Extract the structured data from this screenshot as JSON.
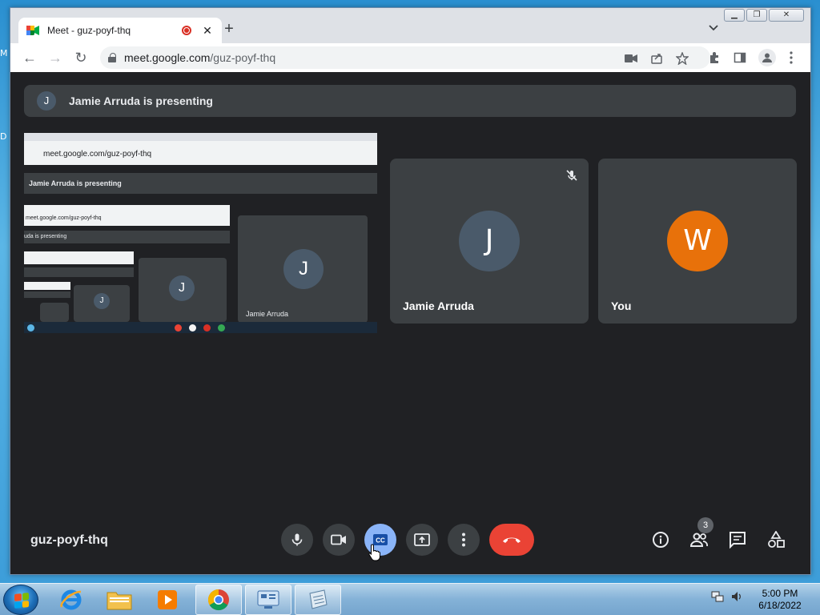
{
  "desktop": {
    "edge_letters": [
      "M",
      "D"
    ]
  },
  "browser": {
    "tab": {
      "title": "Meet - guz-poyf-thq"
    },
    "new_tab": "+",
    "tab_close": "✕",
    "tab_search": "⌄",
    "window_controls": {
      "minimize": "▁",
      "restore": "❐",
      "close": "✕"
    },
    "omnibox": {
      "host": "meet.google.com",
      "path": "/guz-poyf-thq"
    },
    "back": "←",
    "forward": "→",
    "reload": "↻"
  },
  "meet": {
    "presenting_banner": {
      "avatar_letter": "J",
      "text": "Jamie Arruda is presenting"
    },
    "shared_screen": {
      "url": "meet.google.com/guz-poyf-thq",
      "banner": "Jamie Arruda is presenting",
      "nested_url": "meet.google.com/guz-poyf-thq",
      "nested_banner": "uda is presenting",
      "tile_letter": "J",
      "tile_name": "Jamie Arruda"
    },
    "participants": [
      {
        "name": "Jamie Arruda",
        "letter": "J",
        "color": "#4a5a6a",
        "muted": true
      },
      {
        "name": "You",
        "letter": "W",
        "color": "#e8710a",
        "muted": false
      }
    ],
    "meeting_code": "guz-poyf-thq",
    "controls": {
      "mic": "mic-icon",
      "camera": "camera-icon",
      "captions": "CC",
      "present": "present-screen-icon",
      "more": "more-options-icon",
      "end": "end-call-icon"
    },
    "people_count": "3"
  },
  "taskbar": {
    "clock_time": "5:00 PM",
    "clock_date": "6/18/2022"
  },
  "colors": {
    "meet_bg": "#202124",
    "tile_bg": "#3c4043",
    "end_call": "#ea4335",
    "active_cc": "#8ab4f8",
    "you_avatar": "#e8710a"
  }
}
